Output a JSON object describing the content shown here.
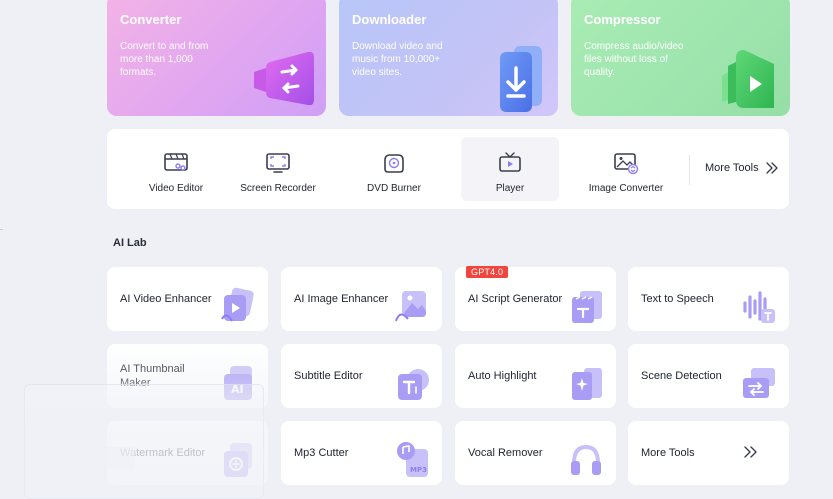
{
  "hero_cards": [
    {
      "id": "converter",
      "title": "Converter",
      "desc": "Convert to and from more than 1,000 formats."
    },
    {
      "id": "downloader",
      "title": "Downloader",
      "desc": "Download video and music from 10,000+ video sites."
    },
    {
      "id": "compressor",
      "title": "Compressor",
      "desc": "Compress audio/video files without loss of quality."
    }
  ],
  "tools": [
    {
      "label": "Video Editor",
      "icon": "video-editor-icon"
    },
    {
      "label": "Screen Recorder",
      "icon": "screen-recorder-icon"
    },
    {
      "label": "DVD Burner",
      "icon": "dvd-burner-icon"
    },
    {
      "label": "Player",
      "icon": "player-icon"
    },
    {
      "label": "Image Converter",
      "icon": "image-converter-icon"
    }
  ],
  "more_tools_label": "More Tools",
  "ai_lab": {
    "title": "AI Lab",
    "badge": "GPT4.0",
    "cards": [
      {
        "label": "AI Video Enhancer"
      },
      {
        "label": "AI Image Enhancer"
      },
      {
        "label": "AI Script Generator"
      },
      {
        "label": "Text to Speech"
      },
      {
        "label": "AI Thumbnail Maker"
      },
      {
        "label": "Subtitle Editor"
      },
      {
        "label": "Auto Highlight"
      },
      {
        "label": "Scene Detection"
      },
      {
        "label": "Watermark Editor"
      },
      {
        "label": "Mp3 Cutter"
      },
      {
        "label": "Vocal Remover"
      },
      {
        "label": "More Tools"
      }
    ]
  },
  "colors": {
    "accent_purple": "#8f7cf2",
    "badge_red": "#f2453d",
    "background": "#eef0f6"
  }
}
